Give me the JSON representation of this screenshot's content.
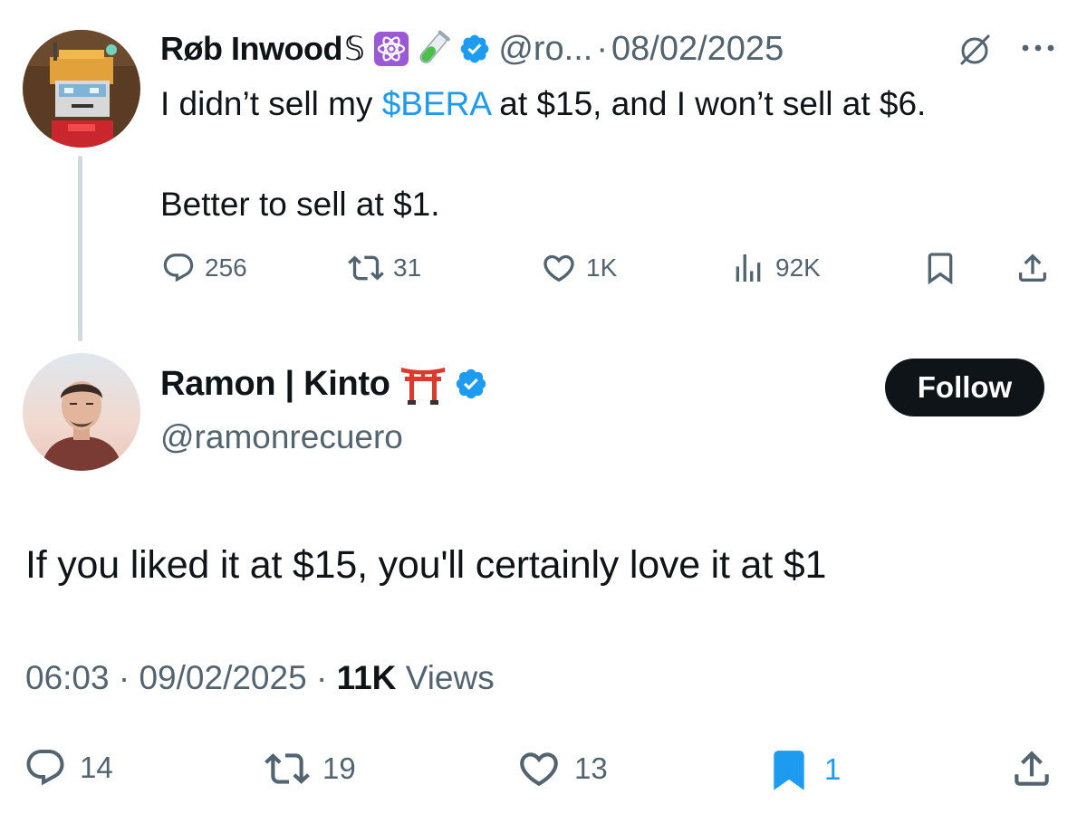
{
  "parent": {
    "name": "Røb Inwood",
    "name_suffix": "𝕊",
    "handle": "@ro...",
    "separator": "·",
    "date": "08/02/2025",
    "text_line1_before": "I didn’t sell my ",
    "cashtag": "$BERA",
    "text_line1_after": " at $15, and I won’t sell at $6.",
    "text_line2": "Better to sell at $1.",
    "actions": {
      "replies": "256",
      "reposts": "31",
      "likes": "1K",
      "views": "92K"
    },
    "icons": [
      "atom-emoji-icon",
      "test-tube-icon",
      "verified-badge-icon",
      "grok-icon",
      "more-icon"
    ]
  },
  "reply": {
    "name": "Ramon | Kinto",
    "handle": "@ramonrecuero",
    "follow_label": "Follow",
    "text": "If you liked it at $15, you'll certainly love it at $1",
    "time": "06:03",
    "separator": "·",
    "date": "09/02/2025",
    "views_count": "11K",
    "views_label": "Views",
    "actions": {
      "replies": "14",
      "reposts": "19",
      "likes": "13",
      "bookmarks": "1"
    },
    "icons": [
      "torii-gate-icon",
      "verified-badge-icon"
    ]
  },
  "colors": {
    "text": "#0f1419",
    "secondary": "#536471",
    "accent": "#1d9bf0",
    "thread_line": "#cfd9de"
  }
}
